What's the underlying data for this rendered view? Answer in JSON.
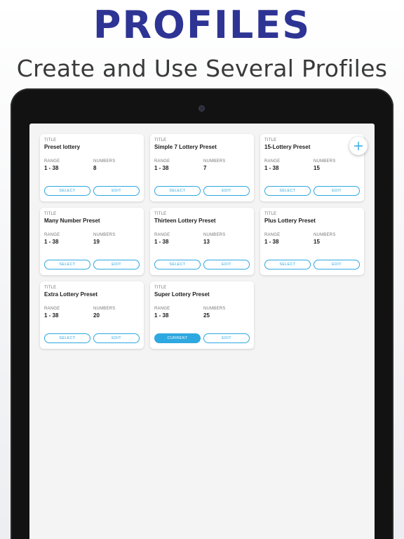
{
  "header": {
    "title": "PROFILES",
    "subtitle": "Create and Use Several Profiles"
  },
  "labels": {
    "title": "TITLE",
    "range": "RANGE",
    "numbers": "NUMBERS"
  },
  "profiles": [
    {
      "title": "Preset lottery",
      "range": "1 - 38",
      "numbers": "8",
      "left_button": "SELECT",
      "right_button": "EDIT"
    },
    {
      "title": "Simple 7 Lottery Preset",
      "range": "1 - 38",
      "numbers": "7",
      "left_button": "SELECT",
      "right_button": "EDIT"
    },
    {
      "title": "15-Lottery Preset",
      "range": "1 - 38",
      "numbers": "15",
      "left_button": "SELECT",
      "right_button": "EDIT"
    },
    {
      "title": "Many Number Preset",
      "range": "1 - 38",
      "numbers": "19",
      "left_button": "SELECT",
      "right_button": "EDIT"
    },
    {
      "title": "Thirteen Lottery Preset",
      "range": "1 - 38",
      "numbers": "13",
      "left_button": "SELECT",
      "right_button": "EDIT"
    },
    {
      "title": "Plus Lottery Preset",
      "range": "1 - 38",
      "numbers": "15",
      "left_button": "SELECT",
      "right_button": "EDIT"
    },
    {
      "title": "Extra Lottery Preset",
      "range": "1 - 38",
      "numbers": "20",
      "left_button": "SELECT",
      "right_button": "EDIT"
    },
    {
      "title": "Super Lottery Preset",
      "range": "1 - 38",
      "numbers": "25",
      "left_button": "CURRENT",
      "right_button": "EDIT",
      "is_current": true
    }
  ],
  "colors": {
    "headline": "#2e3494",
    "accent": "#2ea8e0",
    "device": "#121212"
  },
  "icons": {
    "fab": "plus-icon"
  }
}
